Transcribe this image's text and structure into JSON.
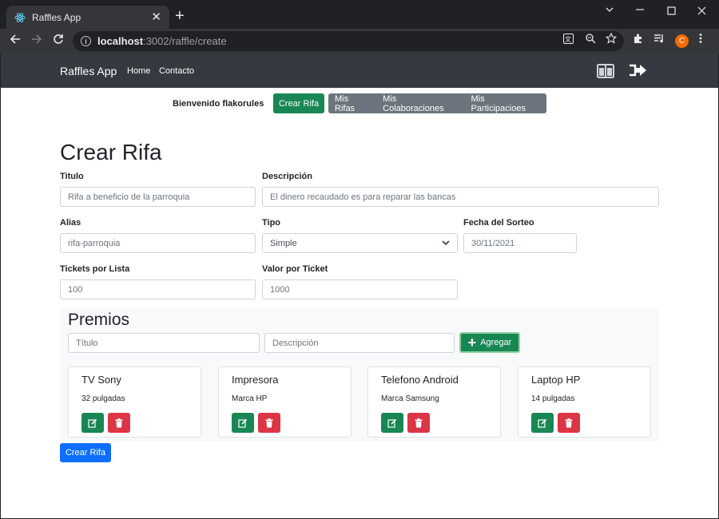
{
  "browser": {
    "tab_title": "Raffles App",
    "tab_close": "✕",
    "new_tab": "+",
    "url_host": "localhost",
    "url_path": ":3002/raffle/create",
    "avatar_letter": "C"
  },
  "navbar": {
    "brand": "Raffles App",
    "links": [
      "Home",
      "Contacto"
    ]
  },
  "subnav": {
    "welcome": "Bienvenido flakorules",
    "create": "Crear Rifa",
    "group": [
      "Mis Rifas",
      "Mis Colaboraciones",
      "Mis Participacioes"
    ]
  },
  "form": {
    "title": "Crear Rifa",
    "titulo": {
      "label": "Titulo",
      "value": "Rifa a beneficio de la parroquia"
    },
    "descripcion": {
      "label": "Descripción",
      "value": "El dinero recaudado es para reparar las bancas"
    },
    "alias": {
      "label": "Alias",
      "value": "rifa-parroquia"
    },
    "tipo": {
      "label": "Tipo",
      "value": "Simple"
    },
    "fecha": {
      "label": "Fecha del Sorteo",
      "value": "30/11/2021"
    },
    "tickets": {
      "label": "Tickets por Lista",
      "value": "100"
    },
    "valor": {
      "label": "Valor por Ticket",
      "value": "1000"
    }
  },
  "premios": {
    "title": "Premios",
    "titulo_placeholder": "Título",
    "desc_placeholder": "Descripción",
    "add_label": "Agregar",
    "items": [
      {
        "title": "TV Sony",
        "desc": "32 pulgadas"
      },
      {
        "title": "Impresora",
        "desc": "Marca HP"
      },
      {
        "title": "Telefono Android",
        "desc": "Marca Samsung"
      },
      {
        "title": "Laptop HP",
        "desc": "14 pulgadas"
      }
    ]
  },
  "submit_label": "Crear Rifa",
  "colors": {
    "success": "#198754",
    "danger": "#dc3545",
    "primary": "#0d6efd",
    "navbar": "#343a40"
  }
}
